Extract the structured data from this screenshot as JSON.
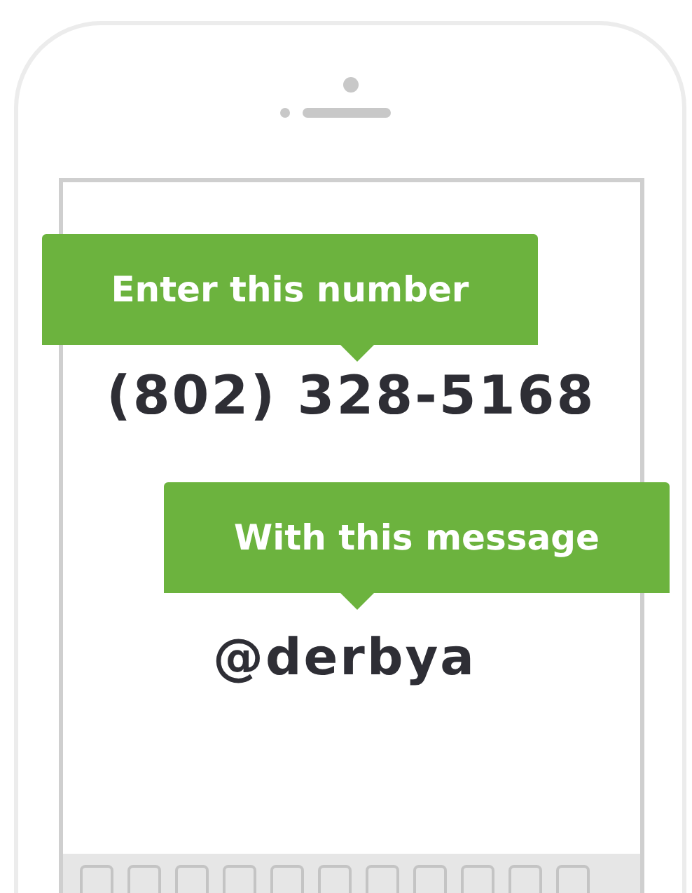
{
  "steps": [
    {
      "callout": "Enter this number",
      "value": "(802) 328-5168"
    },
    {
      "callout": "With this message",
      "value": "@derbya"
    }
  ]
}
